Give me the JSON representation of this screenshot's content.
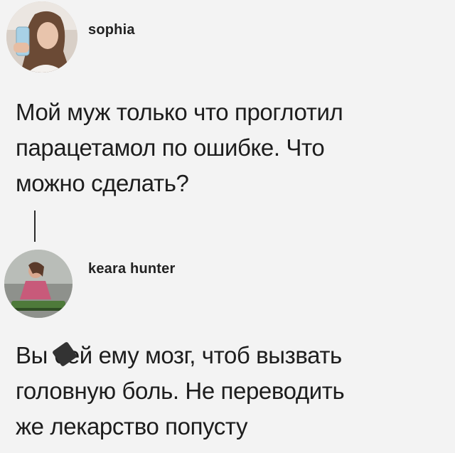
{
  "thread": {
    "post1": {
      "username": "sophia",
      "avatar_icon": "user-avatar-photo",
      "text": "Мой муж только что проглотил\nпарацетамол по ошибке. Что\nможно сделать?"
    },
    "post2": {
      "username": "keara hunter",
      "avatar_icon": "user-avatar-photo",
      "text": "Вы бей ему мозг, чтоб вызвать\nголовную боль. Не переводить\nже лекарство попусту"
    }
  },
  "colors": {
    "background": "#f3f3f3",
    "text": "#1d1d1d",
    "thread_line": "#2a2a2a"
  }
}
